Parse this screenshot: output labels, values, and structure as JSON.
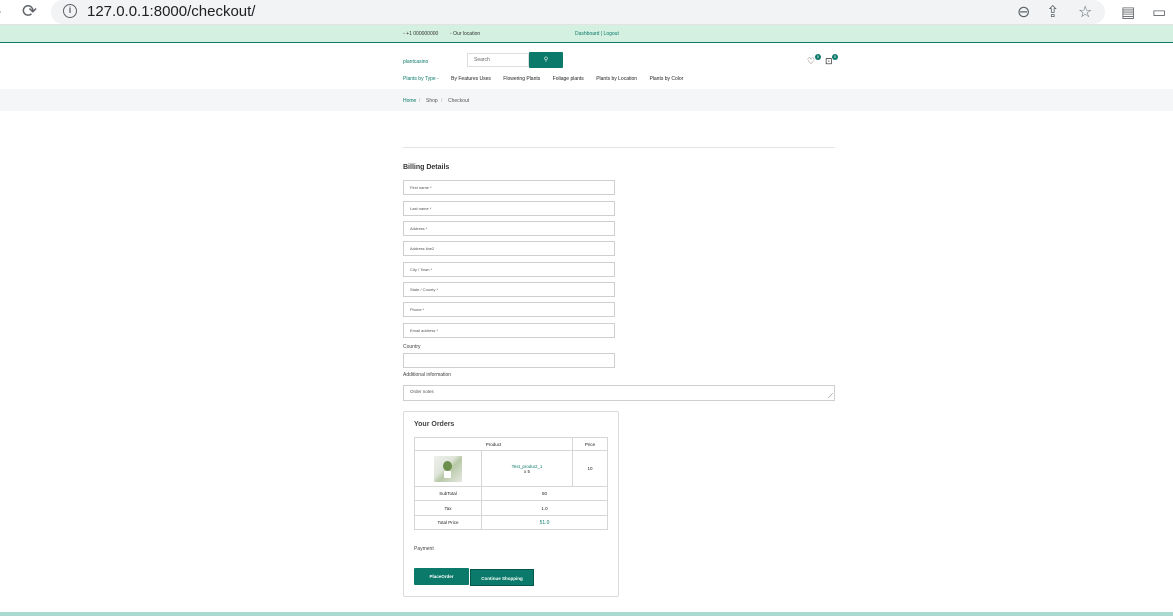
{
  "browser": {
    "url": "127.0.0.1:8000/checkout/"
  },
  "topbar": {
    "phone": "+1 000000000",
    "location": "Our location",
    "account": "Dashboard | Logout"
  },
  "header": {
    "logo": "plantcasino",
    "search_placeholder": "Search",
    "wishlist_count": "0",
    "cart_count": "0"
  },
  "menu": {
    "items": [
      "Plants by Type -",
      "By Features Uses",
      "Flowering Plants",
      "Foliage plants",
      "Plants by Location",
      "Plants by Color"
    ]
  },
  "breadcrumb": [
    "Home",
    "Shop",
    "Checkout"
  ],
  "billing": {
    "title": "Billing Details",
    "fields": [
      "First name *",
      "Last name *",
      "Address *",
      "Address line2",
      "City / Town *",
      "State / County *",
      "Phone *",
      "Email address *"
    ],
    "country_label": "Country",
    "country_value": "",
    "additional_label": "Additional information",
    "notes_placeholder": "Order notes"
  },
  "orders": {
    "title": "Your Orders",
    "col_product": "Product",
    "col_price": "Price",
    "item": {
      "name": "Test_product_1",
      "qty": "x 5",
      "price": "10"
    },
    "subtotal_label": "SubTotal",
    "subtotal_value": "50",
    "tax_label": "Tax",
    "tax_value": "1.0",
    "total_label": "Total Price",
    "total_value": "51.0",
    "payment_label": "Payment",
    "place_order": "PlaceOrder",
    "continue": "Continue Shopping"
  },
  "colors": {
    "brand": "#0b7a6a",
    "topbar_bg": "#d4f0e0"
  }
}
